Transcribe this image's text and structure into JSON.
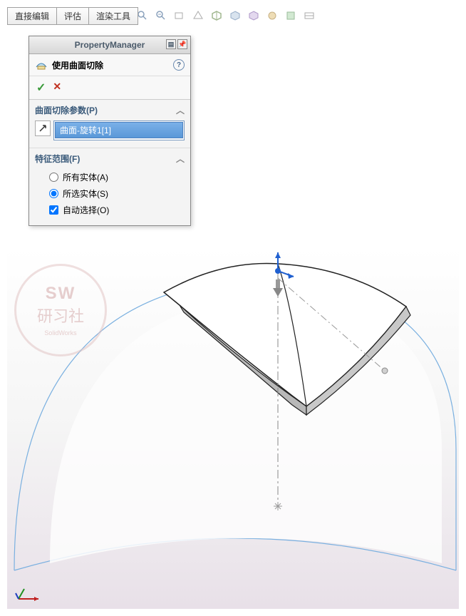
{
  "menubar": {
    "direct_edit": "直接编辑",
    "evaluate": "评估",
    "render_tools": "渲染工具"
  },
  "property_manager": {
    "header": "PropertyManager",
    "feature_title": "使用曲面切除",
    "ok": "✓",
    "cancel": "✕",
    "help": "?",
    "section_params": {
      "title": "曲面切除参数(P)",
      "selected_item": "曲面-旋转1[1]"
    },
    "section_scope": {
      "title": "特征范围(F)",
      "opt_all": "所有实体(A)",
      "opt_selected": "所选实体(S)",
      "opt_auto": "自动选择(O)"
    }
  },
  "watermark": {
    "line1": "SW",
    "line2": "研习社",
    "line3": "SolidWorks"
  }
}
